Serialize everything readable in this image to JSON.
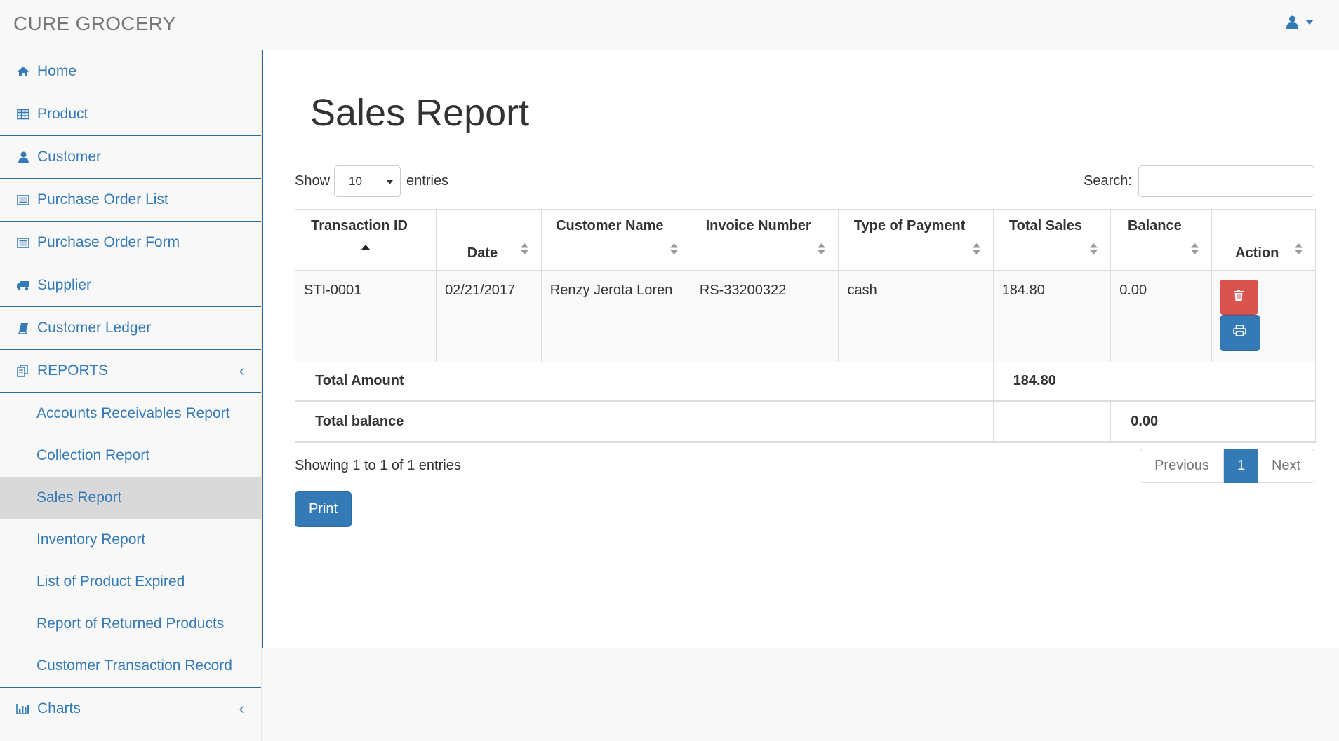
{
  "app": {
    "brand": "CURE GROCERY"
  },
  "sidebar": {
    "items": [
      {
        "label": "Home",
        "icon": "home-icon"
      },
      {
        "label": "Product",
        "icon": "table-icon"
      },
      {
        "label": "Customer",
        "icon": "user-icon"
      },
      {
        "label": "Purchase Order List",
        "icon": "list-alt-icon"
      },
      {
        "label": "Purchase Order Form",
        "icon": "list-alt-icon"
      },
      {
        "label": "Supplier",
        "icon": "truck-icon"
      },
      {
        "label": "Customer Ledger",
        "icon": "book-icon"
      }
    ],
    "reports": {
      "label": "REPORTS",
      "icon": "files-icon",
      "chevron": "‹",
      "subitems": [
        "Accounts Receivables Report",
        "Collection Report",
        "Sales Report",
        "Inventory Report",
        "List of Product Expired",
        "Report of Returned Products",
        "Customer Transaction Record"
      ],
      "active_index": 2
    },
    "charts": {
      "label": "Charts",
      "icon": "bar-chart-icon",
      "chevron": "‹"
    }
  },
  "main": {
    "title": "Sales Report",
    "length": {
      "prefix": "Show",
      "value": "10",
      "suffix": "entries"
    },
    "search": {
      "label": "Search:",
      "value": ""
    },
    "table": {
      "columns": [
        "Transaction ID",
        "Date",
        "Customer Name",
        "Invoice Number",
        "Type of Payment",
        "Total Sales",
        "Balance",
        "Action"
      ],
      "rows": [
        [
          "STI-0001",
          "02/21/2017",
          "Renzy Jerota Loren",
          "RS-33200322",
          "cash",
          "184.80",
          "0.00"
        ]
      ],
      "footer": {
        "total_amount_label": "Total Amount",
        "total_amount": "184.80",
        "total_balance_label": "Total balance",
        "total_balance": "0.00"
      }
    },
    "info": "Showing 1 to 1 of 1 entries",
    "pagination": {
      "previous": "Previous",
      "current": "1",
      "next": "Next"
    },
    "print_label": "Print"
  },
  "colors": {
    "primary": "#337ab7",
    "danger": "#d9534f",
    "active_bg": "#d9d9d9"
  }
}
